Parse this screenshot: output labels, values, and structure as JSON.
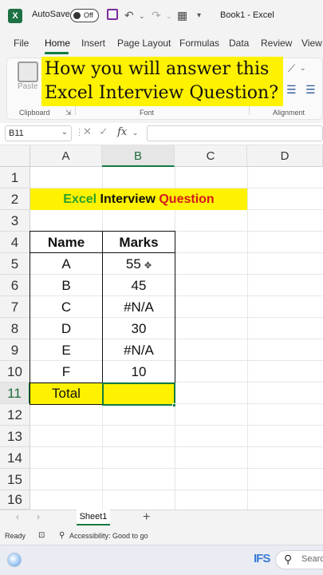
{
  "titlebar": {
    "app_logo": "X",
    "autosave_label": "AutoSave",
    "autosave_state": "Off",
    "book_title": "Book1  -  Excel"
  },
  "menu": {
    "tabs": [
      "File",
      "Home",
      "Insert",
      "Page Layout",
      "Formulas",
      "Data",
      "Review",
      "View"
    ],
    "active": "Home"
  },
  "ribbon": {
    "paste_label": "Paste",
    "groups": [
      "Clipboard",
      "Font",
      "Alignment"
    ],
    "overlay_line1": "How you will answer this",
    "overlay_line2": "Excel Interview Question?"
  },
  "formula_bar": {
    "name_box": "B11",
    "fx_label": "fx",
    "value": ""
  },
  "grid": {
    "columns": [
      "A",
      "B",
      "C",
      "D"
    ],
    "selected_column": "B",
    "rows": [
      "1",
      "2",
      "3",
      "4",
      "5",
      "6",
      "7",
      "8",
      "9",
      "10",
      "11",
      "12",
      "13",
      "14",
      "15",
      "16"
    ],
    "selected_row": "11",
    "title": {
      "word1": "Excel",
      "word2": "Interview",
      "word3": "Question"
    },
    "table": {
      "headers": [
        "Name",
        "Marks"
      ],
      "rows": [
        [
          "A",
          "55"
        ],
        [
          "B",
          "45"
        ],
        [
          "C",
          "#N/A"
        ],
        [
          "D",
          "30"
        ],
        [
          "E",
          "#N/A"
        ],
        [
          "F",
          "10"
        ]
      ],
      "total_label": "Total",
      "total_value": ""
    }
  },
  "sheets": {
    "tabs": [
      "Sheet1"
    ],
    "active": "Sheet1"
  },
  "status": {
    "ready": "Ready",
    "accessibility": "Accessibility: Good to go"
  },
  "taskbar": {
    "search_label": "Search",
    "watermark": "IFS"
  },
  "colors": {
    "excel_green": "#107c41",
    "highlight_yellow": "#fff200",
    "title_green": "#2aa12a",
    "title_red": "#d4191c"
  }
}
